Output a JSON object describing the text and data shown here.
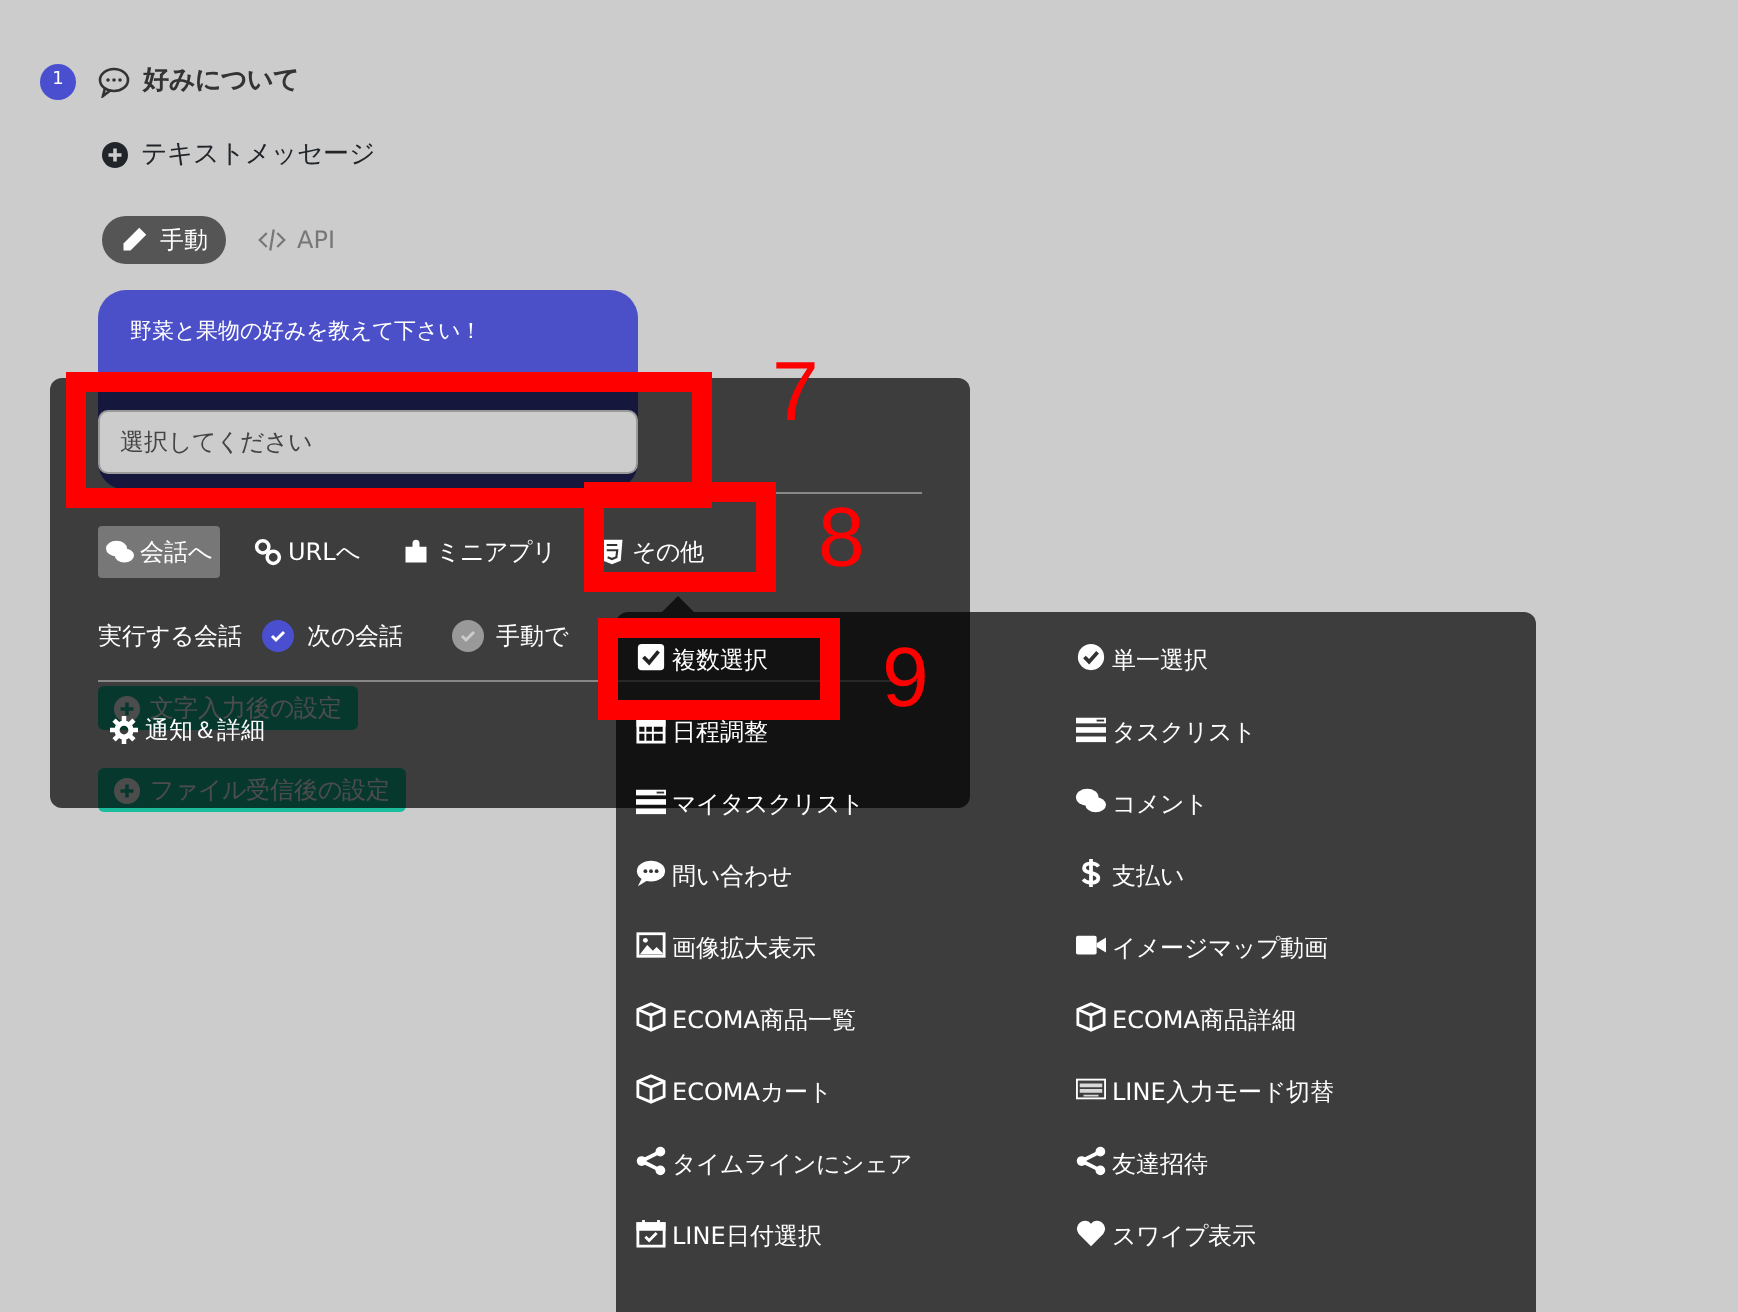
{
  "step": {
    "number": "1",
    "title": "好みについて"
  },
  "add_message": "テキストメッセージ",
  "mode_tabs": [
    {
      "label": "手動",
      "selected": true,
      "kind": "pencil"
    },
    {
      "label": "API",
      "selected": false,
      "kind": "code"
    }
  ],
  "bubble": {
    "text": "野菜と果物の好みを教えて下さい！"
  },
  "background_buttons": [
    {
      "label": "文字入力後の設定"
    },
    {
      "label": "ファイル受信後の設定"
    }
  ],
  "popup": {
    "select": {
      "placeholder": "選択してください"
    },
    "action_tabs": [
      {
        "label": "会話へ",
        "selected": true,
        "kind": "comments"
      },
      {
        "label": "URLへ",
        "selected": false,
        "kind": "link"
      },
      {
        "label": "ミニアプリ",
        "selected": false,
        "kind": "puzzle"
      },
      {
        "label": "その他",
        "selected": false,
        "kind": "html5"
      }
    ],
    "target": {
      "label": "実行する会話",
      "options": [
        {
          "label": "次の会話",
          "selected": true
        },
        {
          "label": "手動で",
          "selected": false
        }
      ]
    },
    "details": "通知＆詳細"
  },
  "menu": {
    "items": [
      {
        "label": "複数選択",
        "kind": "checkbox"
      },
      {
        "label": "単一選択",
        "kind": "checkcircle"
      },
      {
        "label": "日程調整",
        "kind": "calendar"
      },
      {
        "label": "タスクリスト",
        "kind": "tasks"
      },
      {
        "label": "マイタスクリスト",
        "kind": "tasks"
      },
      {
        "label": "コメント",
        "kind": "comments"
      },
      {
        "label": "問い合わせ",
        "kind": "comment"
      },
      {
        "label": "支払い",
        "kind": "dollar"
      },
      {
        "label": "画像拡大表示",
        "kind": "image"
      },
      {
        "label": "イメージマップ動画",
        "kind": "video"
      },
      {
        "label": "ECOMA商品一覧",
        "kind": "cube"
      },
      {
        "label": "ECOMA商品詳細",
        "kind": "cube"
      },
      {
        "label": "ECOMAカート",
        "kind": "cube"
      },
      {
        "label": "LINE入力モード切替",
        "kind": "keyboard"
      },
      {
        "label": "タイムラインにシェア",
        "kind": "share"
      },
      {
        "label": "友達招待",
        "kind": "share"
      },
      {
        "label": "LINE日付選択",
        "kind": "calcheck"
      },
      {
        "label": "スワイプ表示",
        "kind": "heart"
      }
    ]
  },
  "annotations": [
    {
      "label": "7"
    },
    {
      "label": "8"
    },
    {
      "label": "9"
    }
  ]
}
